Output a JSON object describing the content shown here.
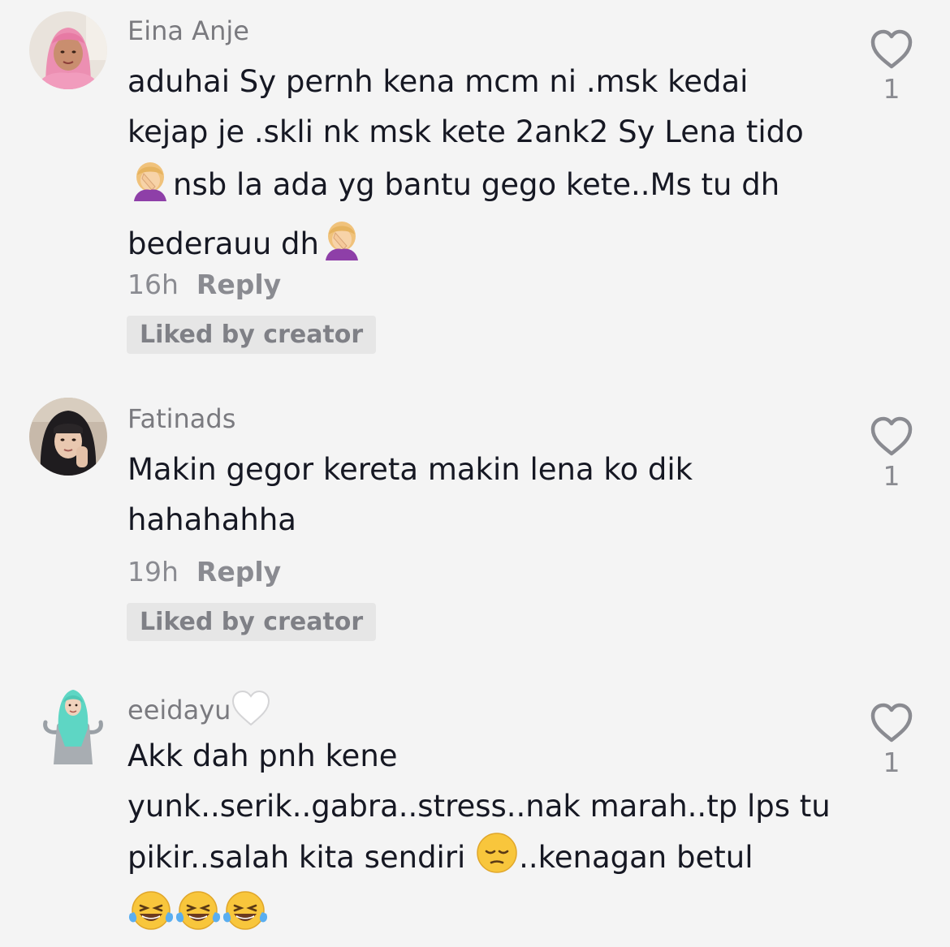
{
  "colors": {
    "background": "#f4f4f4",
    "username": "#7a7a7f",
    "text": "#161823",
    "meta": "#8a8b91",
    "badge_bg": "#e6e6e6"
  },
  "comments": [
    {
      "username": "Eina Anje",
      "text_parts": [
        "aduhai Sy pernh kena mcm ni .msk kedai kejap je .skli nk msk kete 2ank2 Sy Lena tido",
        "nsb la ada yg bantu gego kete..Ms tu dh bederauu dh"
      ],
      "emojis": [
        "face-palm-emoji",
        "face-palm-emoji"
      ],
      "time": "16h",
      "reply_label": "Reply",
      "badge": "Liked by creator",
      "like_icon": "heart-outline-icon",
      "likes": "1"
    },
    {
      "username": "Fatinads",
      "text": "Makin gegor kereta makin lena ko dik hahahahha",
      "time": "19h",
      "reply_label": "Reply",
      "badge": "Liked by creator",
      "like_icon": "heart-outline-icon",
      "likes": "1"
    },
    {
      "username": "eeidayu",
      "username_emoji": "white-heart-emoji",
      "text_parts": [
        "Akk dah pnh kene yunk..serik..gabra..stress..nak marah..tp lps tu pikir..salah kita sendiri ",
        "..kenagan betul"
      ],
      "emojis": [
        "pensive-face-emoji",
        "laughing-tears-emoji",
        "laughing-tears-emoji",
        "laughing-tears-emoji"
      ],
      "like_icon": "heart-outline-icon",
      "likes": "1"
    }
  ]
}
